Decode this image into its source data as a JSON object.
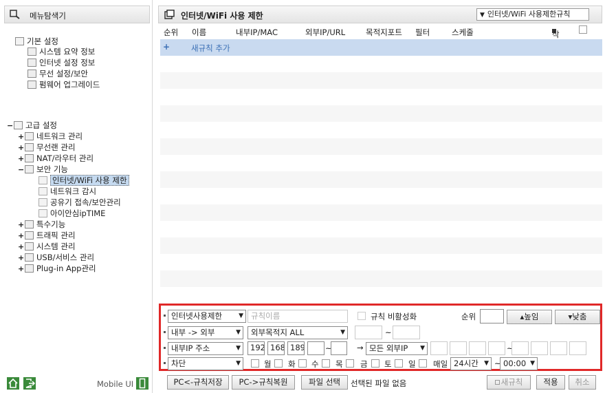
{
  "sidebar": {
    "title": "메뉴탐색기",
    "basic": {
      "label": "기본 설정",
      "items": [
        "시스템 요약 정보",
        "인터넷 설정 정보",
        "무선 설정/보안",
        "펌웨어 업그레이드"
      ]
    },
    "advanced": {
      "label": "고급 설정",
      "expand": "−",
      "items": [
        {
          "label": "네트워크 관리",
          "expand": "+"
        },
        {
          "label": "무선랜 관리",
          "expand": "+"
        },
        {
          "label": "NAT/라우터 관리",
          "expand": "+"
        },
        {
          "label": "보안 기능",
          "expand": "−"
        }
      ],
      "security_items": [
        "인터넷/WiFi 사용 제한",
        "네트워크 감시",
        "공유기 접속/보안관리",
        "아이안심ipTIME"
      ],
      "more_items": [
        {
          "label": "특수기능",
          "expand": "+"
        },
        {
          "label": "트래픽 관리",
          "expand": "+"
        },
        {
          "label": "시스템 관리",
          "expand": "+"
        },
        {
          "label": "USB/서비스 관리",
          "expand": "+"
        },
        {
          "label": "Plug-in App관리",
          "expand": "+"
        }
      ]
    },
    "footer": {
      "mobile_ui": "Mobile UI"
    }
  },
  "main": {
    "title": "인터넷/WiFi 사용 제한",
    "rule_select": "인터넷/WiFi 사용제한규칙",
    "columns": [
      "순위",
      "이름",
      "내부IP/MAC",
      "외부IP/URL",
      "목적지포트",
      "필터",
      "스케줄",
      "삭제"
    ],
    "add_rule": "새규칙 추가",
    "add_plus": "+"
  },
  "form": {
    "type_select": "인터넷사용제한",
    "name_placeholder": "규칙이름",
    "disable_label": "규칙 비활성화",
    "rank_label": "순위",
    "up_btn": "▴높임",
    "down_btn": "▾낮춤",
    "direction": "내부 -> 외부",
    "dest_select": "외부목적지 ALL",
    "tilde": "~",
    "src_select": "내부IP 주소",
    "ip": [
      "192",
      "168",
      "189",
      ""
    ],
    "arrow": "→",
    "dst_ip_select": "모든 외부IP",
    "action": "차단",
    "days": [
      "월",
      "화",
      "수",
      "목",
      "금",
      "토",
      "일"
    ],
    "everyday": "매일",
    "time_select": "24시간",
    "time_start": "00:00"
  },
  "bottom": {
    "save_btn": "PC<-규칙저장",
    "restore_btn": "PC->규칙복원",
    "file_btn": "파일 선택",
    "file_status": "선택된 파일 없음",
    "new_rule_btn": "새규칙",
    "apply_btn": "적용",
    "cancel_btn": "취소"
  },
  "colors": {
    "accent": "#e02828",
    "row_highlight": "#c9daf0",
    "link": "#3b6fb5"
  }
}
